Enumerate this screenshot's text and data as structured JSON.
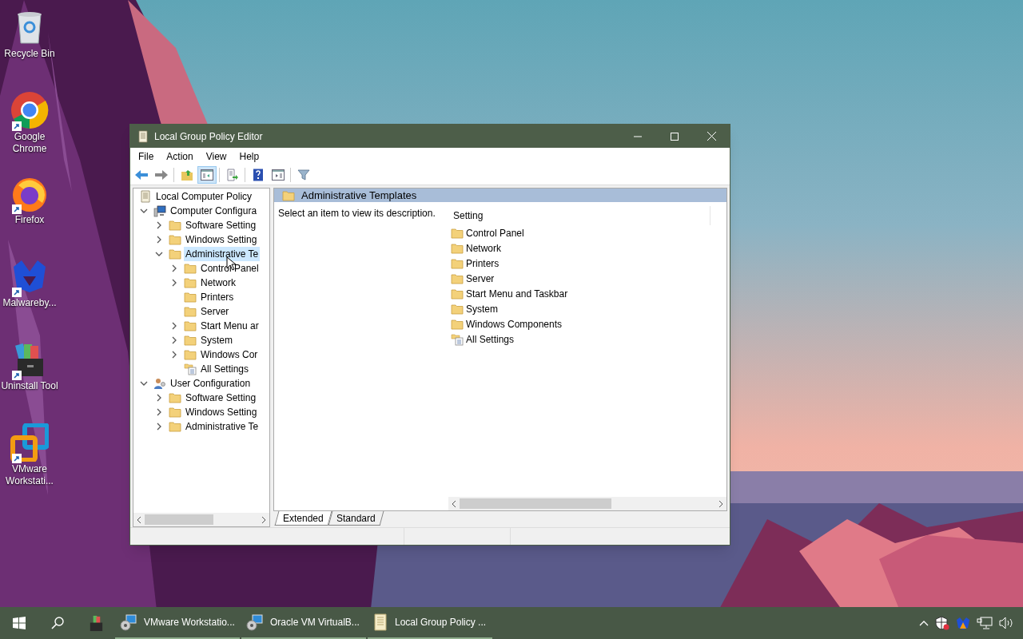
{
  "desktop_icons": [
    {
      "label": "Recycle Bin"
    },
    {
      "label": "Google Chrome"
    },
    {
      "label": "Firefox"
    },
    {
      "label": "Malwareby..."
    },
    {
      "label": "Uninstall Tool"
    },
    {
      "label": "VMware Workstati..."
    }
  ],
  "window": {
    "title": "Local Group Policy Editor",
    "menu": [
      "File",
      "Action",
      "View",
      "Help"
    ],
    "toolbar": [
      {
        "pressed": false
      },
      {
        "pressed": false
      },
      {
        "pressed": false
      },
      {
        "pressed": true
      },
      {
        "pressed": false
      },
      {
        "pressed": false
      },
      {
        "pressed": false
      },
      {
        "pressed": false
      }
    ],
    "tree": [
      {
        "label": "Local Computer Policy",
        "kind": "policy",
        "selected": false,
        "children": [
          {
            "label": "Computer Configura",
            "kind": "computer",
            "expanded": true,
            "selected": false,
            "children": [
              {
                "label": "Software Setting",
                "kind": "folder",
                "expanded": false,
                "selected": false
              },
              {
                "label": "Windows Setting",
                "kind": "folder",
                "expanded": false,
                "selected": false
              },
              {
                "label": "Administrative Te",
                "kind": "folder",
                "expanded": true,
                "selected": true,
                "children": [
                  {
                    "label": "Control Panel",
                    "kind": "folder",
                    "expanded": false,
                    "selected": false
                  },
                  {
                    "label": "Network",
                    "kind": "folder",
                    "expanded": false,
                    "selected": false
                  },
                  {
                    "label": "Printers",
                    "kind": "folder",
                    "selected": false
                  },
                  {
                    "label": "Server",
                    "kind": "folder",
                    "selected": false
                  },
                  {
                    "label": "Start Menu ar",
                    "kind": "folder",
                    "expanded": false,
                    "selected": false
                  },
                  {
                    "label": "System",
                    "kind": "folder",
                    "expanded": false,
                    "selected": false
                  },
                  {
                    "label": "Windows Cor",
                    "kind": "folder",
                    "expanded": false,
                    "selected": false
                  },
                  {
                    "label": "All Settings",
                    "kind": "settings",
                    "selected": false
                  }
                ]
              }
            ]
          },
          {
            "label": "User Configuration",
            "kind": "user",
            "expanded": true,
            "selected": false,
            "children": [
              {
                "label": "Software Setting",
                "kind": "folder",
                "expanded": false,
                "selected": false
              },
              {
                "label": "Windows Setting",
                "kind": "folder",
                "expanded": false,
                "selected": false
              },
              {
                "label": "Administrative Te",
                "kind": "folder",
                "expanded": false,
                "selected": false
              }
            ]
          }
        ]
      }
    ],
    "detail": {
      "header": "Administrative Templates",
      "description": "Select an item to view its description.",
      "column": "Setting",
      "items": [
        {
          "label": "Control Panel",
          "kind": "folder"
        },
        {
          "label": "Network",
          "kind": "folder"
        },
        {
          "label": "Printers",
          "kind": "folder"
        },
        {
          "label": "Server",
          "kind": "folder"
        },
        {
          "label": "Start Menu and Taskbar",
          "kind": "folder"
        },
        {
          "label": "System",
          "kind": "folder"
        },
        {
          "label": "Windows Components",
          "kind": "folder"
        },
        {
          "label": "All Settings",
          "kind": "settings"
        }
      ],
      "tabs": [
        {
          "label": "Extended",
          "selected": true
        },
        {
          "label": "Standard",
          "selected": false
        }
      ]
    }
  },
  "taskbar": {
    "apps": [
      {
        "label": "VMware Workstatio..."
      },
      {
        "label": "Oracle VM VirtualB..."
      },
      {
        "label": "Local Group Policy ..."
      }
    ]
  }
}
